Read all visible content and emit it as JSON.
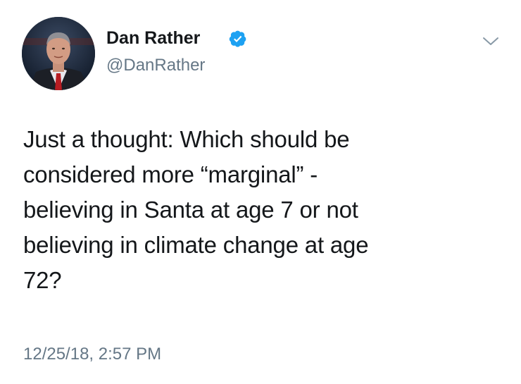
{
  "tweet": {
    "display_name": "Dan Rather",
    "handle": "@DanRather",
    "verified": true,
    "text_lines": [
      "Just a thought: Which should be",
      "considered more “marginal” -",
      "believing in Santa at age 7 or not",
      "believing in climate change at age",
      "72?"
    ],
    "timestamp": "12/25/18, 2:57 PM"
  },
  "icons": {
    "verified": "verified-badge-icon",
    "menu": "chevron-down-icon"
  },
  "colors": {
    "text": "#14171a",
    "secondary_text": "#657786",
    "verified_blue": "#1da1f2",
    "background": "#ffffff"
  }
}
